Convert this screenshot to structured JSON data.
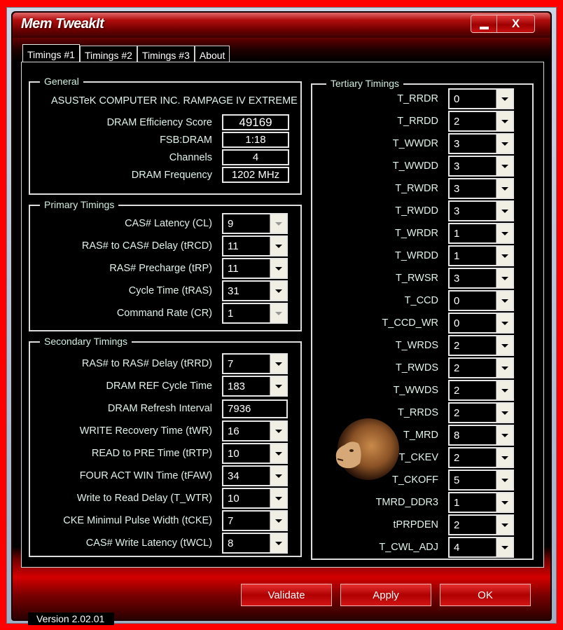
{
  "window": {
    "title": "Mem TweakIt",
    "minimize_label": "_",
    "close_label": "X"
  },
  "tabs": [
    {
      "label": "Timings #1",
      "active": true
    },
    {
      "label": "Timings #2",
      "active": false
    },
    {
      "label": "Timings #3",
      "active": false
    },
    {
      "label": "About",
      "active": false
    }
  ],
  "general": {
    "title": "General",
    "board": "ASUSTeK COMPUTER INC. RAMPAGE IV EXTREME",
    "fields": [
      {
        "label": "DRAM Efficiency Score",
        "value": "49169"
      },
      {
        "label": "FSB:DRAM",
        "value": "1:18"
      },
      {
        "label": "Channels",
        "value": "4"
      },
      {
        "label": "DRAM Frequency",
        "value": "1202 MHz"
      }
    ]
  },
  "primary": {
    "title": "Primary Timings",
    "fields": [
      {
        "label": "CAS# Latency (CL)",
        "value": "9",
        "disabled": true
      },
      {
        "label": "RAS# to CAS# Delay (tRCD)",
        "value": "11",
        "disabled": false
      },
      {
        "label": "RAS# Precharge (tRP)",
        "value": "11",
        "disabled": false
      },
      {
        "label": "Cycle Time (tRAS)",
        "value": "31",
        "disabled": false
      },
      {
        "label": "Command Rate (CR)",
        "value": "1",
        "disabled": true
      }
    ]
  },
  "secondary": {
    "title": "Secondary Timings",
    "fields": [
      {
        "label": "RAS# to RAS# Delay (tRRD)",
        "value": "7",
        "type": "combo"
      },
      {
        "label": "DRAM REF Cycle Time",
        "value": "183",
        "type": "combo"
      },
      {
        "label": "DRAM Refresh Interval",
        "value": "7936",
        "type": "text"
      },
      {
        "label": "WRITE Recovery Time (tWR)",
        "value": "16",
        "type": "combo"
      },
      {
        "label": "READ to PRE Time (tRTP)",
        "value": "10",
        "type": "combo"
      },
      {
        "label": "FOUR ACT WIN Time (tFAW)",
        "value": "34",
        "type": "combo"
      },
      {
        "label": "Write to Read Delay (T_WTR)",
        "value": "10",
        "type": "combo"
      },
      {
        "label": "CKE Minimul Pulse Width (tCKE)",
        "value": "7",
        "type": "combo"
      },
      {
        "label": "CAS# Write Latency (tWCL)",
        "value": "8",
        "type": "combo"
      }
    ]
  },
  "tertiary": {
    "title": "Tertiary Timings",
    "fields": [
      {
        "label": "T_RRDR",
        "value": "0"
      },
      {
        "label": "T_RRDD",
        "value": "2"
      },
      {
        "label": "T_WWDR",
        "value": "3"
      },
      {
        "label": "T_WWDD",
        "value": "3"
      },
      {
        "label": "T_RWDR",
        "value": "3"
      },
      {
        "label": "T_RWDD",
        "value": "3"
      },
      {
        "label": "T_WRDR",
        "value": "1"
      },
      {
        "label": "T_WRDD",
        "value": "1"
      },
      {
        "label": "T_RWSR",
        "value": "3"
      },
      {
        "label": "T_CCD",
        "value": "0"
      },
      {
        "label": "T_CCD_WR",
        "value": "0"
      },
      {
        "label": "T_WRDS",
        "value": "2"
      },
      {
        "label": "T_RWDS",
        "value": "2"
      },
      {
        "label": "T_WWDS",
        "value": "2"
      },
      {
        "label": "T_RRDS",
        "value": "2"
      },
      {
        "label": "T_MRD",
        "value": "8"
      },
      {
        "label": "T_CKEV",
        "value": "2"
      },
      {
        "label": "T_CKOFF",
        "value": "5"
      },
      {
        "label": "TMRD_DDR3",
        "value": "1"
      },
      {
        "label": "tPRPDEN",
        "value": "2"
      },
      {
        "label": "T_CWL_ADJ",
        "value": "4"
      }
    ]
  },
  "buttons": {
    "validate": "Validate",
    "apply": "Apply",
    "ok": "OK"
  },
  "status": {
    "version": "Version 2.02.01"
  },
  "colors": {
    "frame": "#ff0000",
    "accent": "#c00000",
    "label_text": "#dff3ea"
  }
}
